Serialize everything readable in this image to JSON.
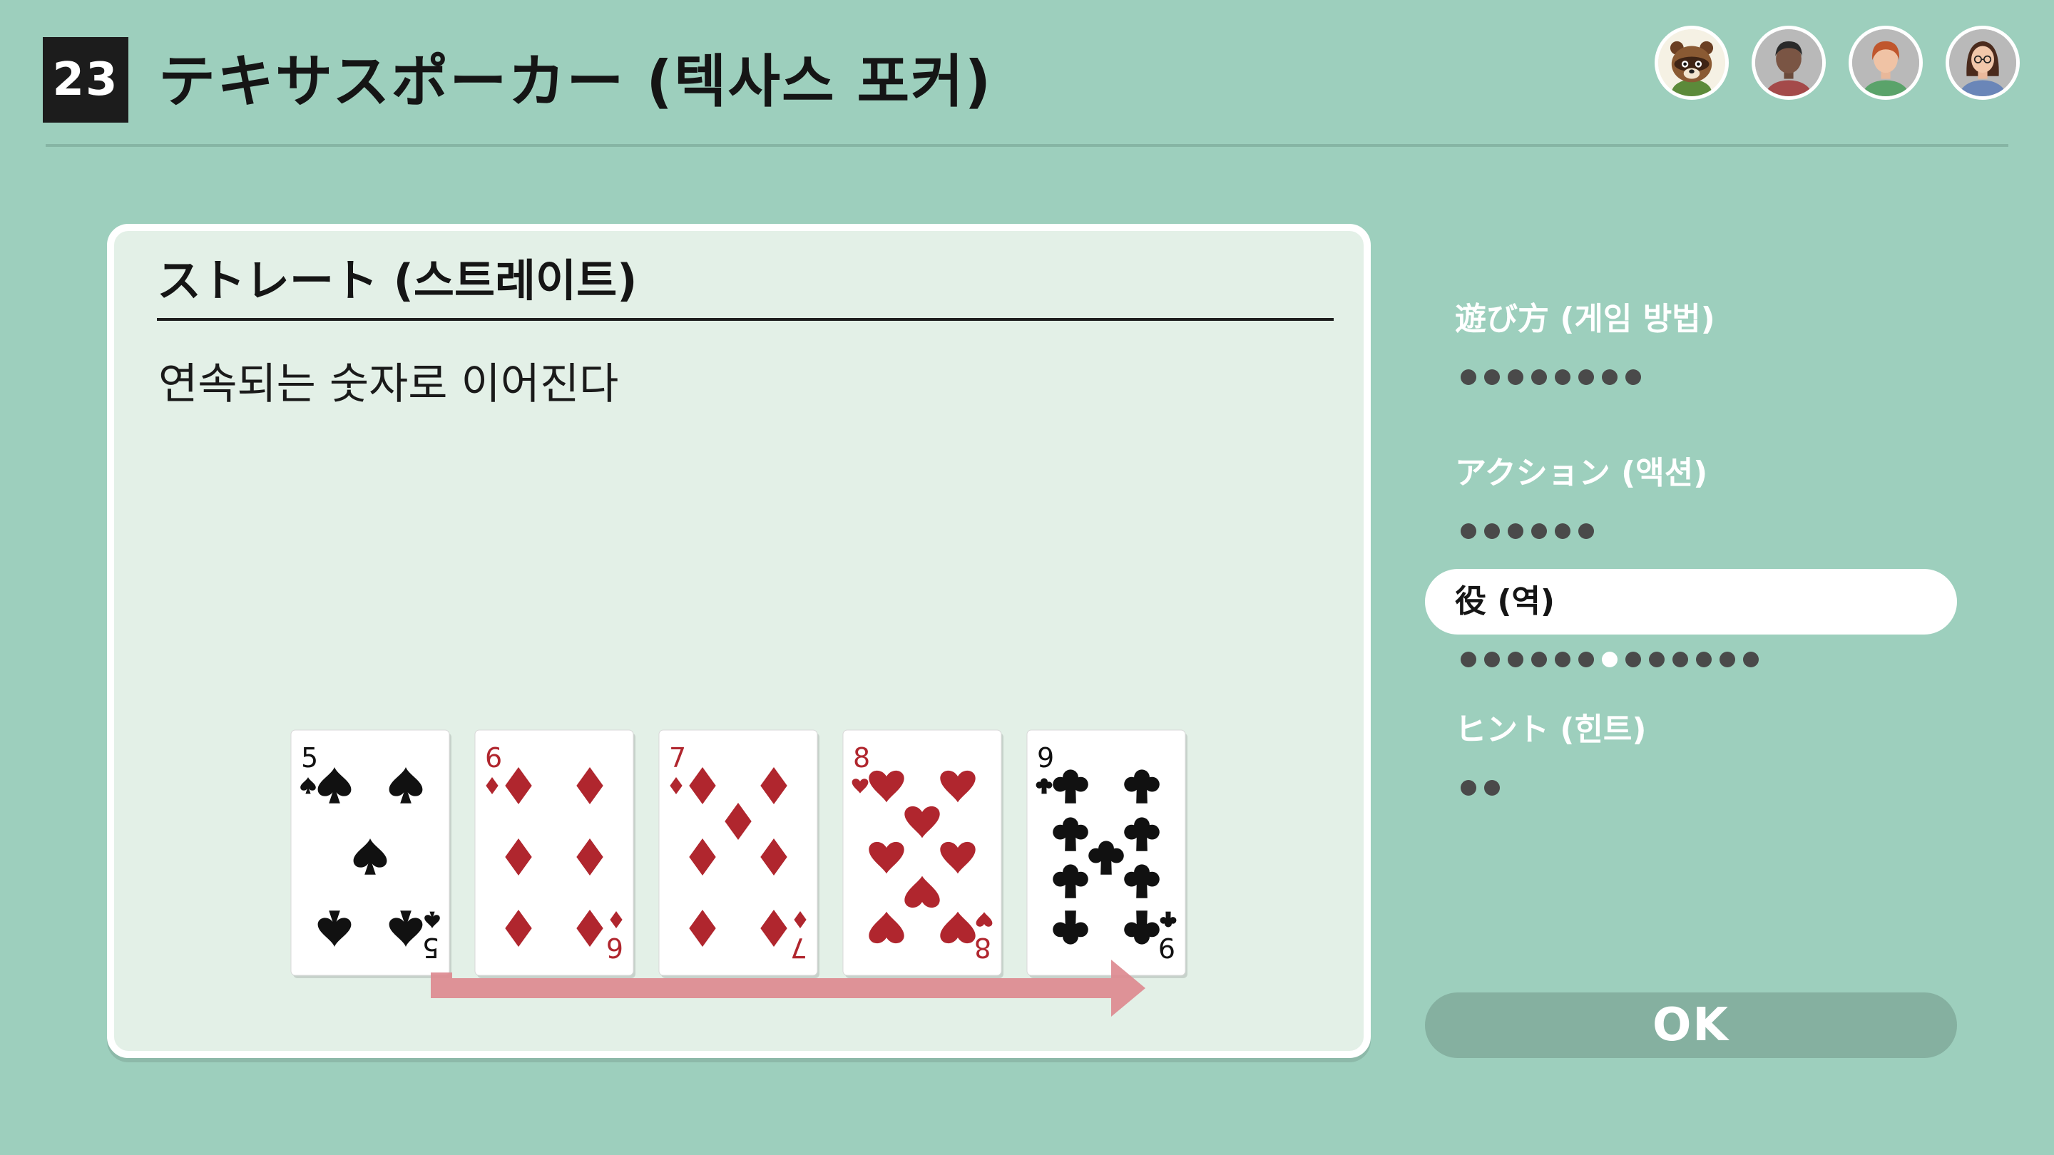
{
  "header": {
    "game_number": "23",
    "title": "テキサスポーカー (텍사스 포커)"
  },
  "players": [
    {
      "name": "raccoon-character-avatar"
    },
    {
      "name": "player-avatar-dark-hair"
    },
    {
      "name": "player-avatar-red-hair"
    },
    {
      "name": "player-avatar-glasses"
    }
  ],
  "panel": {
    "heading": "ストレート (스트레이트)",
    "description": "연속되는 숫자로 이어진다"
  },
  "cards": [
    {
      "rank": "5",
      "suit": "spade",
      "color": "#111111"
    },
    {
      "rank": "6",
      "suit": "diamond",
      "color": "#b0262e"
    },
    {
      "rank": "7",
      "suit": "diamond",
      "color": "#b0262e"
    },
    {
      "rank": "8",
      "suit": "heart",
      "color": "#b0262e"
    },
    {
      "rank": "9",
      "suit": "club",
      "color": "#111111"
    }
  ],
  "arrow": {
    "color": "#dd8a90"
  },
  "menu": {
    "sections": [
      {
        "label": "遊び方 (게임 방법)",
        "pages": 8,
        "current": null
      },
      {
        "label": "アクション (액션)",
        "pages": 6,
        "current": null
      },
      {
        "label": "役 (역)",
        "pages": 13,
        "current": 7,
        "active": true
      },
      {
        "label": "ヒント (힌트)",
        "pages": 2,
        "current": null
      }
    ]
  },
  "ok_button": {
    "label": "OK"
  },
  "colors": {
    "background": "#9dcfbd",
    "panel": "#e3f0e7",
    "ok_button": "#85b0a0",
    "dot": "#4a4a4a"
  }
}
